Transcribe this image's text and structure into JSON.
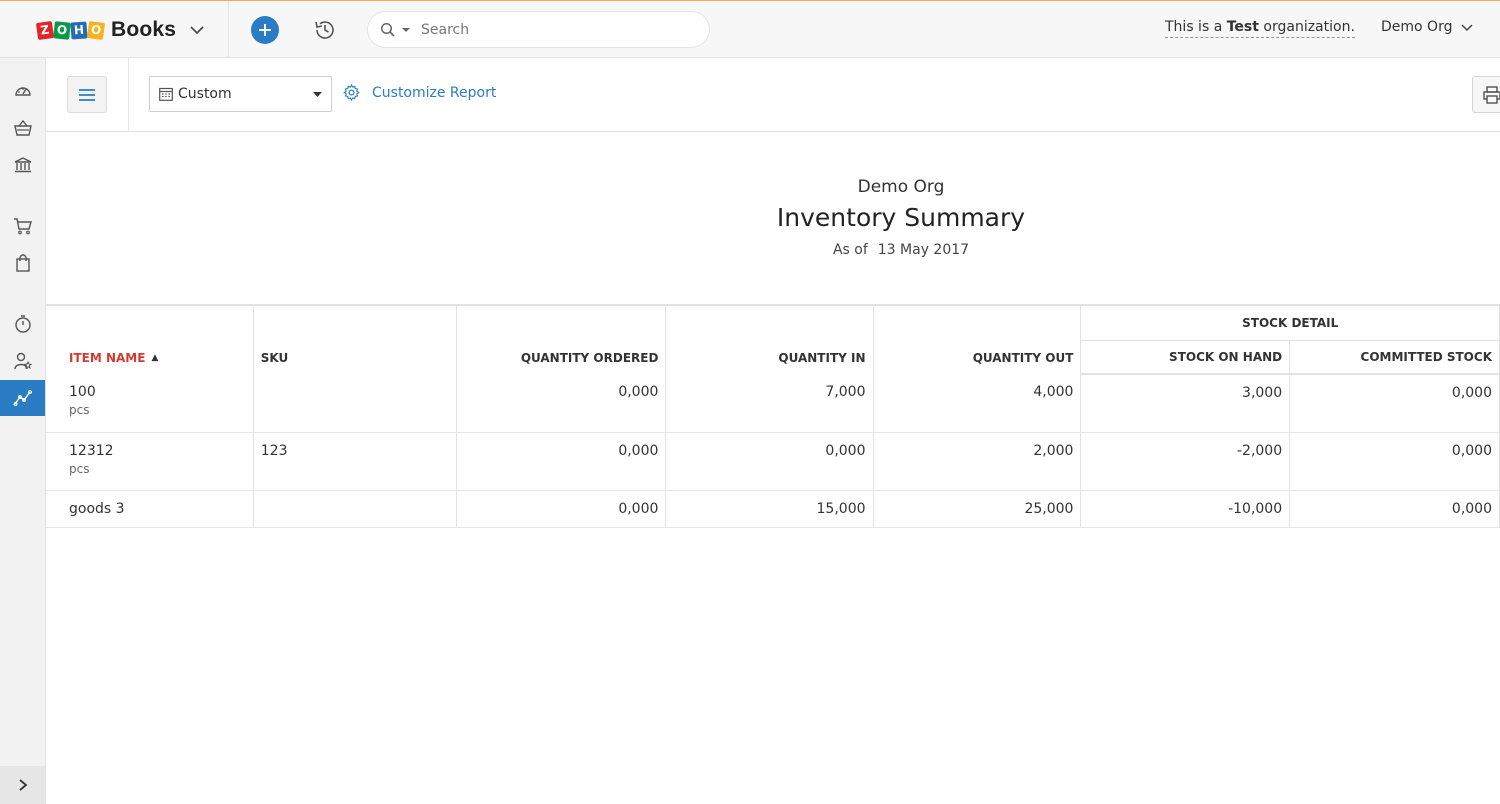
{
  "brand": {
    "logo_letters": [
      "Z",
      "O",
      "H",
      "O"
    ],
    "name": "Books"
  },
  "search": {
    "placeholder": "Search"
  },
  "org_banner": {
    "prefix": "This is a ",
    "bold": "Test",
    "suffix": " organization."
  },
  "org_switch": {
    "label": "Demo Org"
  },
  "rail": {
    "items": [
      "dashboard-icon",
      "items-basket-icon",
      "banking-icon",
      "sales-cart-icon",
      "purchases-bag-icon",
      "time-tracking-icon",
      "accountant-icon",
      "reports-icon"
    ],
    "active": "reports-icon"
  },
  "toolbar": {
    "period": "Custom",
    "customize_label": "Customize Report"
  },
  "report": {
    "org": "Demo Org",
    "title": "Inventory Summary",
    "as_of_label": "As of",
    "as_of_date": "13 May 2017"
  },
  "table": {
    "group_header": "STOCK DETAIL",
    "columns": {
      "item_name": "ITEM NAME",
      "sku": "SKU",
      "quantity_ordered": "QUANTITY ORDERED",
      "quantity_in": "QUANTITY IN",
      "quantity_out": "QUANTITY OUT",
      "stock_on_hand": "STOCK ON HAND",
      "committed_stock": "COMMITTED STOCK"
    },
    "rows": [
      {
        "name": "100",
        "unit": "pcs",
        "sku": "",
        "quantity_ordered": "0,000",
        "quantity_in": "7,000",
        "quantity_out": "4,000",
        "stock_on_hand": "3,000",
        "committed_stock": "0,000"
      },
      {
        "name": "12312",
        "unit": "pcs",
        "sku": "123",
        "quantity_ordered": "0,000",
        "quantity_in": "0,000",
        "quantity_out": "2,000",
        "stock_on_hand": "-2,000",
        "committed_stock": "0,000"
      },
      {
        "name": "goods 3",
        "unit": "",
        "sku": "",
        "quantity_ordered": "0,000",
        "quantity_in": "15,000",
        "quantity_out": "25,000",
        "stock_on_hand": "-10,000",
        "committed_stock": "0,000"
      }
    ]
  },
  "colors": {
    "accent": "#2a7dc4",
    "sorted_header": "#d33b2f",
    "top_border": "#f3a95a"
  }
}
